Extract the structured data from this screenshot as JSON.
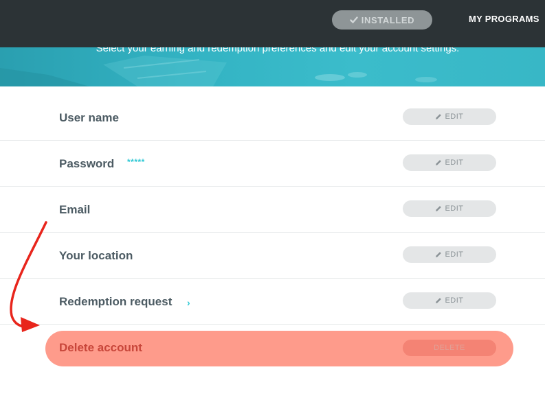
{
  "header": {
    "installed_label": "INSTALLED",
    "my_programs_label": "MY PROGRAMS"
  },
  "hero": {
    "subtitle": "Select your earning and redemption preferences and edit your account settings."
  },
  "settings": {
    "rows": [
      {
        "label": "User name",
        "value": "",
        "edit_label": "EDIT"
      },
      {
        "label": "Password",
        "value": "*****",
        "edit_label": "EDIT"
      },
      {
        "label": "Email",
        "value": "",
        "edit_label": "EDIT"
      },
      {
        "label": "Your location",
        "value": "",
        "edit_label": "EDIT"
      },
      {
        "label": "Redemption request",
        "value": "",
        "chevron": "›",
        "edit_label": "EDIT"
      }
    ],
    "delete": {
      "label": "Delete account",
      "button_label": "DELETE"
    }
  },
  "icons": {
    "installed": "check-icon",
    "edit": "pencil-icon",
    "redemption": "chevron-right-icon",
    "annotation": "red-curved-arrow"
  },
  "colors": {
    "topbar": "#2c3336",
    "hero": "#38b7c6",
    "accent": "#2ec8d4",
    "label": "#4c5b63",
    "delete_bg": "#fe9b8b",
    "delete_text": "#c8463a",
    "annotation": "#e8251c"
  }
}
